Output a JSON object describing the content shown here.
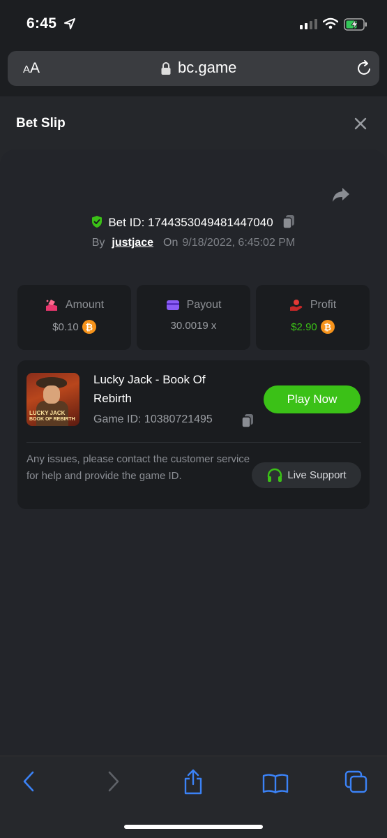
{
  "status": {
    "time": "6:45"
  },
  "browser": {
    "aa_small": "A",
    "aa_big": "A",
    "domain": "bc.game"
  },
  "sheet": {
    "title": "Bet Slip"
  },
  "bet": {
    "id_label": "Bet ID:",
    "id_value": "1744353049481447040",
    "by_label": "By",
    "user": "justjace",
    "on_label": "On",
    "date": "9/18/2022, 6:45:02 PM"
  },
  "stats": {
    "amount_label": "Amount",
    "amount_value": "$0.10",
    "payout_label": "Payout",
    "payout_value": "30.0019 x",
    "profit_label": "Profit",
    "profit_value": "$2.90"
  },
  "game": {
    "name": "Lucky Jack - Book Of Rebirth",
    "id_label": "Game ID:",
    "id_value": "10380721495",
    "thumb_line1": "LUCKY JACK",
    "thumb_line2": "BOOK OF REBIRTH",
    "play_label": "Play Now",
    "note": "Any issues, please contact the customer service for help and provide the game ID.",
    "support_label": "Live Support"
  },
  "colors": {
    "accent_green": "#3bc117",
    "btc_orange": "#f7931a",
    "safari_blue": "#3b82f6"
  },
  "icons": [
    "location-arrow-icon",
    "signal-icon",
    "wifi-icon",
    "battery-charging-icon",
    "lock-icon",
    "reload-icon",
    "close-icon",
    "share-icon",
    "shield-check-icon",
    "copy-icon",
    "amount-icon",
    "payout-icon",
    "profit-icon",
    "bitcoin-icon",
    "headset-icon",
    "back-icon",
    "forward-icon",
    "share-sheet-icon",
    "bookmarks-icon",
    "tabs-icon"
  ]
}
